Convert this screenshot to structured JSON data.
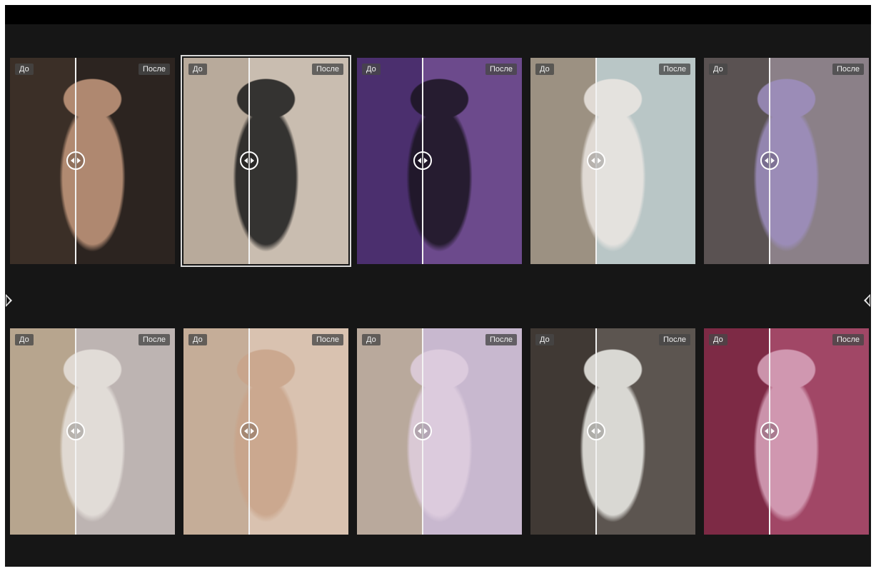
{
  "gallery": {
    "before_label": "До",
    "after_label": "После",
    "selected_index": 1,
    "cards": [
      {
        "split": 0.4,
        "before_bg": "#3b2f27",
        "after_bg": "#2c2420",
        "figure": "#c69a7e"
      },
      {
        "split": 0.4,
        "before_bg": "#b8aa9b",
        "after_bg": "#c9bdb0",
        "figure": "#1b1b1b"
      },
      {
        "split": 0.4,
        "before_bg": "#4b2f6e",
        "after_bg": "#6c4a8c",
        "figure": "#1a1520"
      },
      {
        "split": 0.4,
        "before_bg": "#9c9182",
        "after_bg": "#b9c6c6",
        "figure": "#ece7e3"
      },
      {
        "split": 0.4,
        "before_bg": "#5a5252",
        "after_bg": "#8b8088",
        "figure": "#9e8fc0"
      },
      {
        "split": 0.4,
        "before_bg": "#b7a58e",
        "after_bg": "#bdb4b2",
        "figure": "#e8e3de"
      },
      {
        "split": 0.4,
        "before_bg": "#c5ad98",
        "after_bg": "#d9c2b0",
        "figure": "#c9a48a"
      },
      {
        "split": 0.4,
        "before_bg": "#b9a99c",
        "after_bg": "#c8b8cf",
        "figure": "#e0cfe0"
      },
      {
        "split": 0.4,
        "before_bg": "#403934",
        "after_bg": "#5c5550",
        "figure": "#efefea"
      },
      {
        "split": 0.4,
        "before_bg": "#7d2a45",
        "after_bg": "#a14766",
        "figure": "#d9a6bd"
      }
    ]
  }
}
